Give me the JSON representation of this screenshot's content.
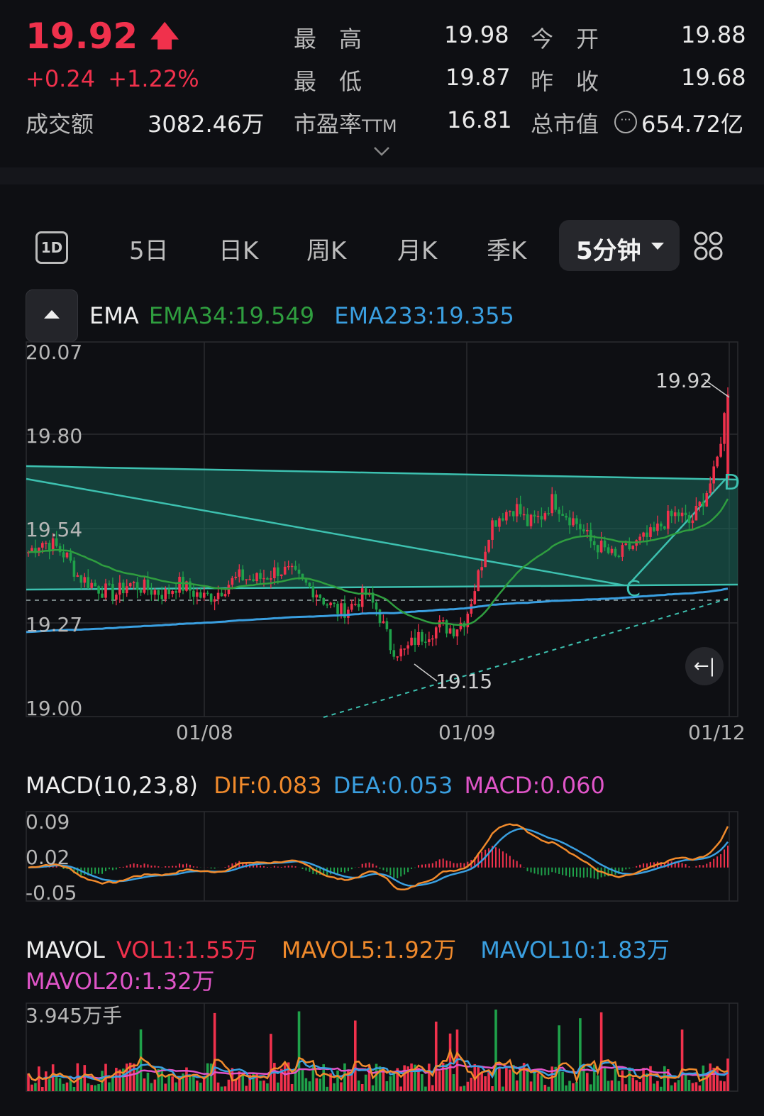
{
  "quote": {
    "price": "19.92",
    "change": "+0.24",
    "change_pct": "+1.22%",
    "high_label": "最　高",
    "high": "19.98",
    "open_label": "今　开",
    "open": "19.88",
    "low_label": "最　低",
    "low": "19.87",
    "prev_close_label": "昨　收",
    "prev_close": "19.68",
    "turnover_label": "成交额",
    "turnover": "3082.46万",
    "pe_label": "市盈率",
    "pe_suffix": "TTM",
    "pe": "16.81",
    "mcap_label": "总市值",
    "mcap": "654.72亿"
  },
  "tabs": {
    "intraday_icon": "1D",
    "items": [
      "5日",
      "日K",
      "周K",
      "月K",
      "季K"
    ],
    "selected": "5分钟",
    "grid_icon": "grid-icon"
  },
  "ema": {
    "name": "EMA",
    "ema34": "EMA34:19.549",
    "ema233": "EMA233:19.355"
  },
  "price_axis": [
    "20.07",
    "19.80",
    "19.54",
    "19.27",
    "19.00"
  ],
  "date_axis": [
    "01/08",
    "01/09",
    "01/12"
  ],
  "annotations": {
    "high_mark": "19.92",
    "low_mark": "19.15",
    "point_c": "C",
    "point_d": "D"
  },
  "macd": {
    "title": "MACD(10,23,8)",
    "dif": "DIF:0.083",
    "dea": "DEA:0.053",
    "macd": "MACD:0.060",
    "axis": [
      "0.09",
      "0.02",
      "-0.05"
    ]
  },
  "mavol": {
    "title": "MAVOL",
    "vol1": "VOL1:1.55万",
    "mavol5": "MAVOL5:1.92万",
    "mavol10": "MAVOL10:1.83万",
    "mavol20": "MAVOL20:1.32万",
    "axis_top": "3.945万手"
  },
  "colors": {
    "up": "#f0314c",
    "down": "#1fa14a",
    "ema34": "#2f9e3f",
    "ema233": "#3a9fe0",
    "dif": "#f08a2c",
    "dea": "#3a9fe0",
    "macd": "#e055c8",
    "mavol20": "#e055c8"
  },
  "chart_data": [
    {
      "type": "candlestick",
      "title": "",
      "ylim": [
        19.0,
        20.07
      ],
      "yticks": [
        20.07,
        19.8,
        19.54,
        19.27,
        19.0
      ],
      "xticks": [
        "01/08",
        "01/09",
        "01/12"
      ],
      "interval": "5分钟",
      "series": [
        {
          "name": "EMA34",
          "last": 19.549
        },
        {
          "name": "EMA233",
          "last": 19.355
        }
      ],
      "last_close": 19.92,
      "period_low": 19.15,
      "close_path": [
        19.47,
        19.5,
        19.49,
        19.46,
        19.4,
        19.38,
        19.36,
        19.35,
        19.38,
        19.37,
        19.36,
        19.35,
        19.38,
        19.36,
        19.34,
        19.35,
        19.38,
        19.4,
        19.39,
        19.4,
        19.42,
        19.41,
        19.38,
        19.36,
        19.32,
        19.3,
        19.32,
        19.35,
        19.3,
        19.2,
        19.18,
        19.22,
        19.24,
        19.26,
        19.25,
        19.28,
        19.4,
        19.55,
        19.58,
        19.6,
        19.55,
        19.57,
        19.62,
        19.58,
        19.55,
        19.5,
        19.48,
        19.45,
        19.48,
        19.5,
        19.52,
        19.56,
        19.58,
        19.55,
        19.62,
        19.7,
        19.92
      ]
    },
    {
      "type": "macd",
      "ylim": [
        -0.05,
        0.09
      ],
      "yticks": [
        0.09,
        0.02,
        -0.05
      ],
      "series": [
        {
          "name": "DIF",
          "last": 0.083
        },
        {
          "name": "DEA",
          "last": 0.053
        },
        {
          "name": "MACD",
          "last": 0.06
        }
      ]
    },
    {
      "type": "bar",
      "title": "MAVOL",
      "ymax_label": "3.945万手",
      "series": [
        {
          "name": "VOL1",
          "last": "1.55万"
        },
        {
          "name": "MAVOL5",
          "last": "1.92万"
        },
        {
          "name": "MAVOL10",
          "last": "1.83万"
        },
        {
          "name": "MAVOL20",
          "last": "1.32万"
        }
      ]
    }
  ]
}
